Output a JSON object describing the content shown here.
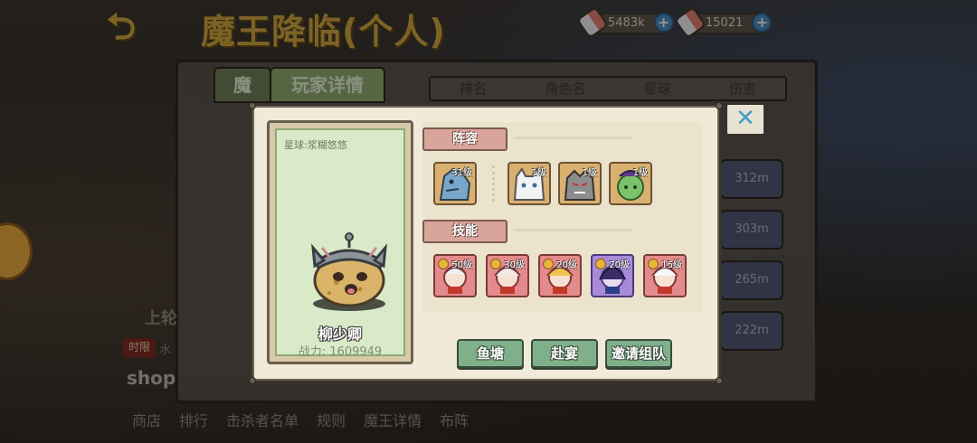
{
  "background": {
    "title": "魔王降临(个人)",
    "currencies": [
      {
        "value": "5483k"
      },
      {
        "value": "15021"
      }
    ],
    "tabs": [
      {
        "label": "魔"
      },
      {
        "label": "玩家详情"
      }
    ],
    "table_headers": [
      "排名",
      "角色名",
      "星球",
      "伤害"
    ],
    "distances": [
      "312m",
      "303m",
      "265m",
      "222m"
    ],
    "side_text": {
      "upper": "上轮",
      "time_badge": "时限",
      "water": "水",
      "shop": "shop"
    },
    "bottom_nav": [
      "商店",
      "排行",
      "击杀者名单",
      "规则",
      "魔王详情",
      "布阵"
    ]
  },
  "player": {
    "planet": "星球:浆糊悠悠",
    "name": "柳少卿",
    "power": "战力: 1609949"
  },
  "lineup": {
    "label": "阵容",
    "heroes": [
      {
        "level": "31级",
        "color": "#7aa7c9"
      },
      {
        "level": "1级",
        "color": "#f2f2f2"
      },
      {
        "level": "1级",
        "color": "#8d8d8d"
      },
      {
        "level": "1级",
        "color": "#7cc26b"
      }
    ]
  },
  "skills": {
    "label": "技能",
    "items": [
      {
        "level": "50级",
        "style": "red"
      },
      {
        "level": "30级",
        "style": "red"
      },
      {
        "level": "20级",
        "style": "red"
      },
      {
        "level": "20级",
        "style": "purple"
      },
      {
        "level": "15级",
        "style": "red"
      }
    ]
  },
  "actions": {
    "fish_pond": "鱼塘",
    "attend_feast": "赴宴",
    "invite_team": "邀请组队"
  },
  "colors": {
    "accent_gold": "#c9a13d",
    "button_green": "#7fb08a",
    "close_blue": "#3f9ec2"
  }
}
